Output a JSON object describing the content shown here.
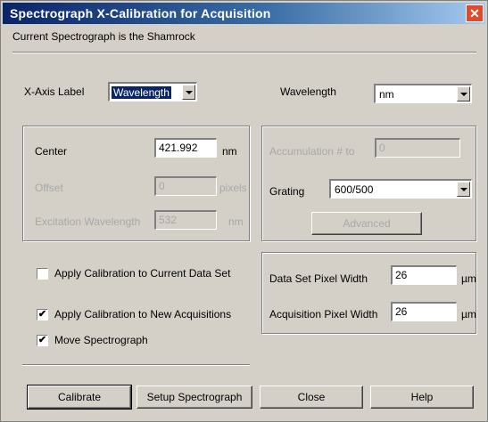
{
  "title": "Spectrograph X-Calibration for Acquisition",
  "current_spectrograph": "Current Spectrograph is the Shamrock",
  "xaxis": {
    "label": "X-Axis Label",
    "value": "Wavelength"
  },
  "units": {
    "label": "Wavelength",
    "value": "nm"
  },
  "left_panel": {
    "center_label": "Center",
    "center_value": "421.992",
    "center_unit": "nm",
    "disabled_label_1": "Offset",
    "disabled_value_1": "0",
    "disabled_unit_1": "pixels",
    "disabled_label_2": "Excitation Wavelength",
    "disabled_value_2": "532",
    "disabled_unit_2": "nm"
  },
  "right_panel": {
    "disabled_label": "Accumulation # to",
    "disabled_value": "0",
    "grating_label": "Grating",
    "grating_value": "600/500",
    "disabled_button": "Advanced"
  },
  "checkboxes": [
    {
      "label": "Apply Calibration to Current Data Set",
      "checked": false
    },
    {
      "label": "Apply Calibration to New Acquisitions",
      "checked": true
    },
    {
      "label": "Move Spectrograph",
      "checked": true
    }
  ],
  "pixel_panel": {
    "dataset_label": "Data Set Pixel Width",
    "dataset_value": "26",
    "dataset_unit": "µm",
    "acq_label": "Acquisition Pixel Width",
    "acq_value": "26",
    "acq_unit": "µm"
  },
  "buttons": {
    "calibrate": "Calibrate",
    "setup": "Setup Spectrograph",
    "close": "Close",
    "help": "Help"
  },
  "check_mark": "✔",
  "close_glyph": "✕"
}
